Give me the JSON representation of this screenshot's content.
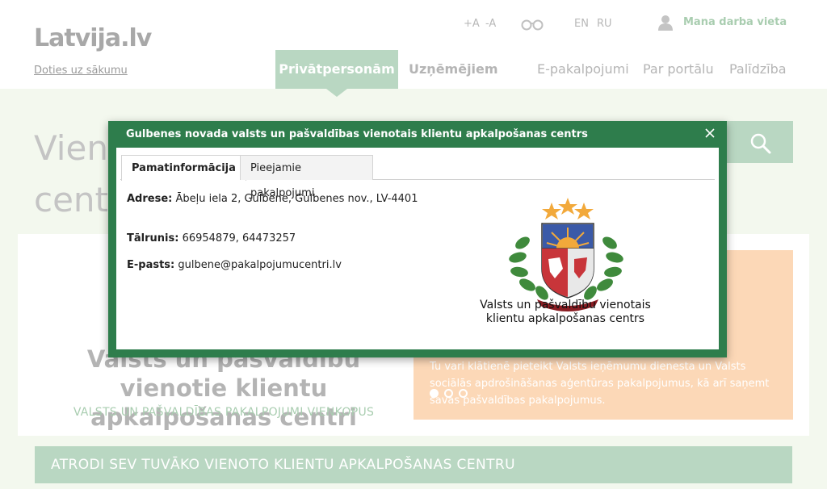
{
  "header": {
    "logo_text": "Latvija.lv",
    "home_link": "Doties uz sākumu",
    "font_increase": "+A",
    "font_decrease": "-A",
    "lang_en": "EN",
    "lang_ru": "RU",
    "workplace": "Mana darba vieta",
    "nav": {
      "private": "Privātpersonām",
      "business": "Uzņēmējiem",
      "eservices": "E-pakalpojumi",
      "about": "Par portālu",
      "help": "Palīdzība"
    }
  },
  "page": {
    "title_line1": "Vieno",
    "title_line2": "centr",
    "card_title": "Valsts un pašvaldību vienotie klientu apkalpošanas centri",
    "card_subtitle": "VALSTS UN PAŠVALDĪBAS PAKALPOJUMI VIENKOPUS",
    "slide_text": "Tu vari klātienē pieteikt Valsts ieņēmumu dienesta un Valsts sociālās apdrošināšanas aģentūras pakalpojumus, kā arī saņemt savas pašvaldības pakalpojumus.",
    "find_bar": "ATRODI SEV TUVĀKO VIENOTO KLIENTU APKALPOŠANAS CENTRU"
  },
  "modal": {
    "title": "Gulbenes novada valsts un pašvaldības vienotais klientu apkalpošanas centrs",
    "tabs": [
      "Pamatinformācija",
      "Pieejamie pakalpojumi"
    ],
    "address_label": "Adrese:",
    "address_value": "Ābeļu iela 2, Gulbene, Gulbenes nov., LV-4401",
    "phone_label": "Tālrunis:",
    "phone_value": "66954879, 64473257",
    "email_label": "E-pasts:",
    "email_value": "gulbene@pakalpojumucentri.lv",
    "emblem_caption_line1": "Valsts un pašvaldību vienotais",
    "emblem_caption_line2": "klientu apkalpošanas centrs"
  },
  "colors": {
    "accent_green": "#b9d7c2",
    "modal_green": "#2e7d4c",
    "orange": "#fcd8b7"
  }
}
